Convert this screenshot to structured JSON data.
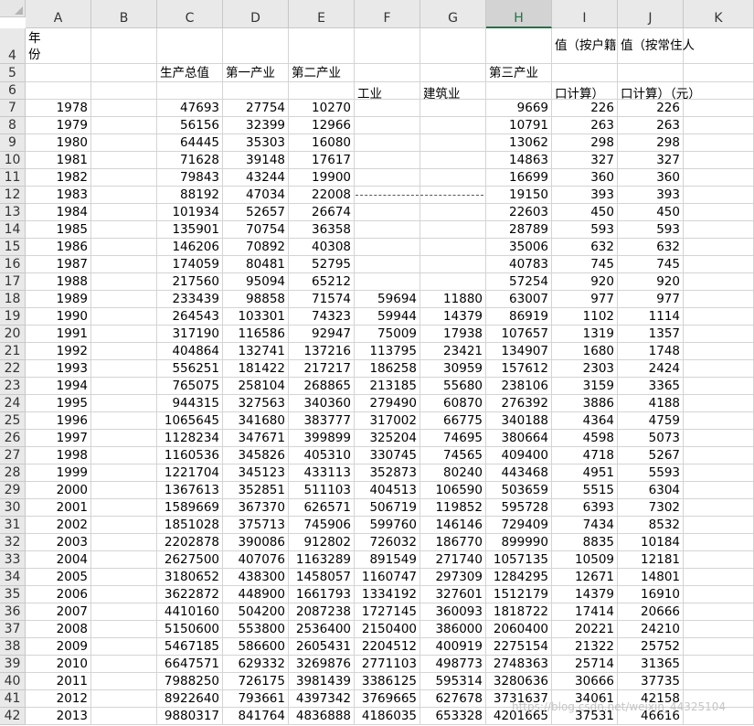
{
  "sheet": {
    "columns": [
      "A",
      "B",
      "C",
      "D",
      "E",
      "F",
      "G",
      "H",
      "I",
      "J",
      "K"
    ],
    "selected_column": "H",
    "header_rows": [
      {
        "row": "4",
        "cells": {
          "A": "年\n份",
          "I": "值（按户籍",
          "J": "值（按常住人"
        }
      },
      {
        "row": "5",
        "cells": {
          "C": "生产总值",
          "D": "第一产业",
          "E": "第二产业",
          "H": "第三产业"
        }
      },
      {
        "row": "6",
        "cells": {
          "F": "工业",
          "G": "建筑业",
          "I": "口计算）",
          "J": "口计算）（元）"
        }
      }
    ],
    "data_rows": [
      {
        "row": "7",
        "year": "1978",
        "c": "47693",
        "d": "27754",
        "e": "10270",
        "f": "",
        "g": "",
        "h": "9669",
        "i": "226",
        "j": "226"
      },
      {
        "row": "8",
        "year": "1979",
        "c": "56156",
        "d": "32399",
        "e": "12966",
        "f": "",
        "g": "",
        "h": "10791",
        "i": "263",
        "j": "263"
      },
      {
        "row": "9",
        "year": "1980",
        "c": "64445",
        "d": "35303",
        "e": "16080",
        "f": "",
        "g": "",
        "h": "13062",
        "i": "298",
        "j": "298"
      },
      {
        "row": "10",
        "year": "1981",
        "c": "71628",
        "d": "39148",
        "e": "17617",
        "f": "",
        "g": "",
        "h": "14863",
        "i": "327",
        "j": "327"
      },
      {
        "row": "11",
        "year": "1982",
        "c": "79843",
        "d": "43244",
        "e": "19900",
        "f": "",
        "g": "",
        "h": "16699",
        "i": "360",
        "j": "360"
      },
      {
        "row": "12",
        "year": "1983",
        "c": "88192",
        "d": "47034",
        "e": "22008",
        "f": "",
        "g": "",
        "h": "19150",
        "i": "393",
        "j": "393"
      },
      {
        "row": "13",
        "year": "1984",
        "c": "101934",
        "d": "52657",
        "e": "26674",
        "f": "",
        "g": "",
        "h": "22603",
        "i": "450",
        "j": "450"
      },
      {
        "row": "14",
        "year": "1985",
        "c": "135901",
        "d": "70754",
        "e": "36358",
        "f": "",
        "g": "",
        "h": "28789",
        "i": "593",
        "j": "593"
      },
      {
        "row": "15",
        "year": "1986",
        "c": "146206",
        "d": "70892",
        "e": "40308",
        "f": "",
        "g": "",
        "h": "35006",
        "i": "632",
        "j": "632"
      },
      {
        "row": "16",
        "year": "1987",
        "c": "174059",
        "d": "80481",
        "e": "52795",
        "f": "",
        "g": "",
        "h": "40783",
        "i": "745",
        "j": "745"
      },
      {
        "row": "17",
        "year": "1988",
        "c": "217560",
        "d": "95094",
        "e": "65212",
        "f": "",
        "g": "",
        "h": "57254",
        "i": "920",
        "j": "920"
      },
      {
        "row": "18",
        "year": "1989",
        "c": "233439",
        "d": "98858",
        "e": "71574",
        "f": "59694",
        "g": "11880",
        "h": "63007",
        "i": "977",
        "j": "977"
      },
      {
        "row": "19",
        "year": "1990",
        "c": "264543",
        "d": "103301",
        "e": "74323",
        "f": "59944",
        "g": "14379",
        "h": "86919",
        "i": "1102",
        "j": "1114"
      },
      {
        "row": "20",
        "year": "1991",
        "c": "317190",
        "d": "116586",
        "e": "92947",
        "f": "75009",
        "g": "17938",
        "h": "107657",
        "i": "1319",
        "j": "1357"
      },
      {
        "row": "21",
        "year": "1992",
        "c": "404864",
        "d": "132741",
        "e": "137216",
        "f": "113795",
        "g": "23421",
        "h": "134907",
        "i": "1680",
        "j": "1748"
      },
      {
        "row": "22",
        "year": "1993",
        "c": "556251",
        "d": "181422",
        "e": "217217",
        "f": "186258",
        "g": "30959",
        "h": "157612",
        "i": "2303",
        "j": "2424"
      },
      {
        "row": "23",
        "year": "1994",
        "c": "765075",
        "d": "258104",
        "e": "268865",
        "f": "213185",
        "g": "55680",
        "h": "238106",
        "i": "3159",
        "j": "3365"
      },
      {
        "row": "24",
        "year": "1995",
        "c": "944315",
        "d": "327563",
        "e": "340360",
        "f": "279490",
        "g": "60870",
        "h": "276392",
        "i": "3886",
        "j": "4188"
      },
      {
        "row": "25",
        "year": "1996",
        "c": "1065645",
        "d": "341680",
        "e": "383777",
        "f": "317002",
        "g": "66775",
        "h": "340188",
        "i": "4364",
        "j": "4759"
      },
      {
        "row": "26",
        "year": "1997",
        "c": "1128234",
        "d": "347671",
        "e": "399899",
        "f": "325204",
        "g": "74695",
        "h": "380664",
        "i": "4598",
        "j": "5073"
      },
      {
        "row": "27",
        "year": "1998",
        "c": "1160536",
        "d": "345826",
        "e": "405310",
        "f": "330745",
        "g": "74565",
        "h": "409400",
        "i": "4718",
        "j": "5267"
      },
      {
        "row": "28",
        "year": "1999",
        "c": "1221704",
        "d": "345123",
        "e": "433113",
        "f": "352873",
        "g": "80240",
        "h": "443468",
        "i": "4951",
        "j": "5593"
      },
      {
        "row": "29",
        "year": "2000",
        "c": "1367613",
        "d": "352851",
        "e": "511103",
        "f": "404513",
        "g": "106590",
        "h": "503659",
        "i": "5515",
        "j": "6304"
      },
      {
        "row": "30",
        "year": "2001",
        "c": "1589669",
        "d": "367370",
        "e": "626571",
        "f": "506719",
        "g": "119852",
        "h": "595728",
        "i": "6393",
        "j": "7302"
      },
      {
        "row": "31",
        "year": "2002",
        "c": "1851028",
        "d": "375713",
        "e": "745906",
        "f": "599760",
        "g": "146146",
        "h": "729409",
        "i": "7434",
        "j": "8532"
      },
      {
        "row": "32",
        "year": "2003",
        "c": "2202878",
        "d": "390086",
        "e": "912802",
        "f": "726032",
        "g": "186770",
        "h": "899990",
        "i": "8835",
        "j": "10184"
      },
      {
        "row": "33",
        "year": "2004",
        "c": "2627500",
        "d": "407076",
        "e": "1163289",
        "f": "891549",
        "g": "271740",
        "h": "1057135",
        "i": "10509",
        "j": "12181"
      },
      {
        "row": "34",
        "year": "2005",
        "c": "3180652",
        "d": "438300",
        "e": "1458057",
        "f": "1160747",
        "g": "297309",
        "h": "1284295",
        "i": "12671",
        "j": "14801"
      },
      {
        "row": "35",
        "year": "2006",
        "c": "3622872",
        "d": "448900",
        "e": "1661793",
        "f": "1334192",
        "g": "327601",
        "h": "1512179",
        "i": "14379",
        "j": "16910"
      },
      {
        "row": "36",
        "year": "2007",
        "c": "4410160",
        "d": "504200",
        "e": "2087238",
        "f": "1727145",
        "g": "360093",
        "h": "1818722",
        "i": "17414",
        "j": "20666"
      },
      {
        "row": "37",
        "year": "2008",
        "c": "5150600",
        "d": "553800",
        "e": "2536400",
        "f": "2150400",
        "g": "386000",
        "h": "2060400",
        "i": "20221",
        "j": "24210"
      },
      {
        "row": "38",
        "year": "2009",
        "c": "5467185",
        "d": "586600",
        "e": "2605431",
        "f": "2204512",
        "g": "400919",
        "h": "2275154",
        "i": "21322",
        "j": "25752"
      },
      {
        "row": "39",
        "year": "2010",
        "c": "6647571",
        "d": "629332",
        "e": "3269876",
        "f": "2771103",
        "g": "498773",
        "h": "2748363",
        "i": "25714",
        "j": "31365"
      },
      {
        "row": "40",
        "year": "2011",
        "c": "7988250",
        "d": "726175",
        "e": "3981439",
        "f": "3386125",
        "g": "595314",
        "h": "3280636",
        "i": "30666",
        "j": "37735"
      },
      {
        "row": "41",
        "year": "2012",
        "c": "8922640",
        "d": "793661",
        "e": "4397342",
        "f": "3769665",
        "g": "627678",
        "h": "3731637",
        "i": "34061",
        "j": "42158"
      },
      {
        "row": "42",
        "year": "2013",
        "c": "9880317",
        "d": "841764",
        "e": "4836888",
        "f": "4186035",
        "g": "653328",
        "h": "4201665",
        "i": "37531",
        "j": "46616"
      }
    ]
  },
  "watermark": "https://blog.csdn.net/weixin_44325104",
  "colors": {
    "accent": "#217346",
    "grid": "#d4d4d4",
    "header_bg": "#e9e9e9"
  }
}
